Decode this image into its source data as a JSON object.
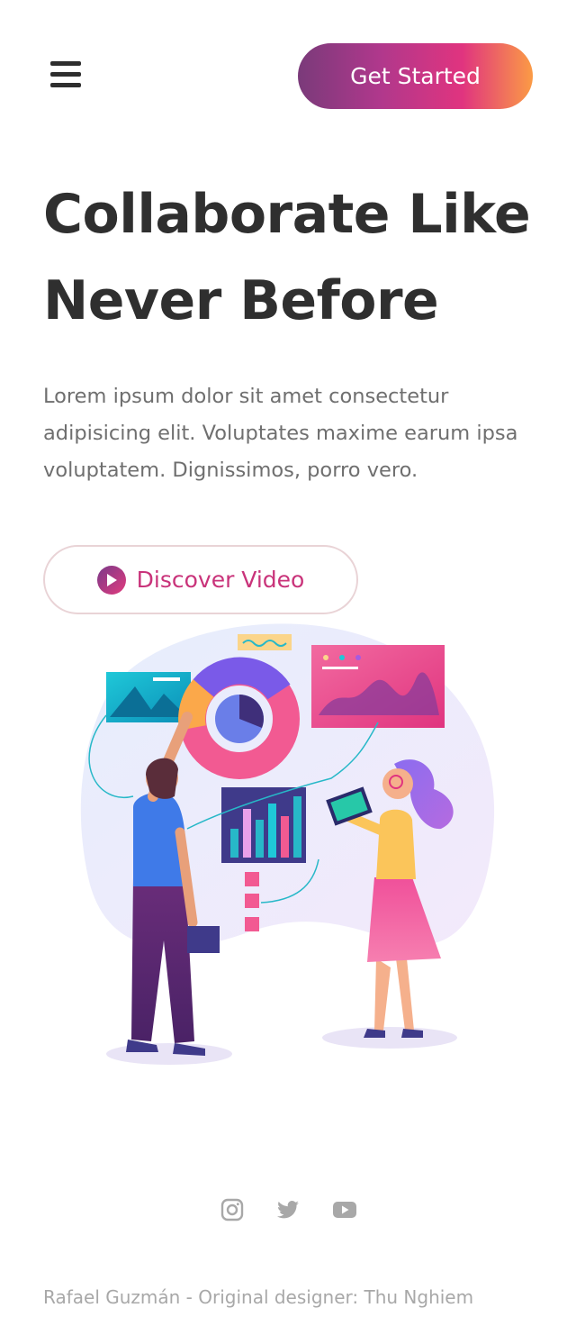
{
  "header": {
    "menu_icon": "hamburger-menu-icon",
    "cta_label": "Get Started",
    "cta_gradient": [
      "#7a3a7a",
      "#e0347f",
      "#fb9b45"
    ]
  },
  "hero": {
    "title": "Collaborate Like Never Before",
    "description": "Lorem ipsum dolor sit amet consectetur adipisicing elit. Voluptates maxime earum ipsa voluptatem. Dignissimos, porro vero.",
    "video_button_label": "Discover Video",
    "video_button_icon": "play-circle-icon"
  },
  "social": {
    "icons": [
      "instagram-icon",
      "twitter-icon",
      "youtube-icon"
    ]
  },
  "footer": {
    "credit": "Rafael Guzmán - Original designer: Thu Nghiem"
  },
  "colors": {
    "text_dark": "#2f2f2f",
    "text_muted": "#6f6f6f",
    "accent_pink": "#c9337a",
    "icon_gray": "#a8a8a8"
  }
}
